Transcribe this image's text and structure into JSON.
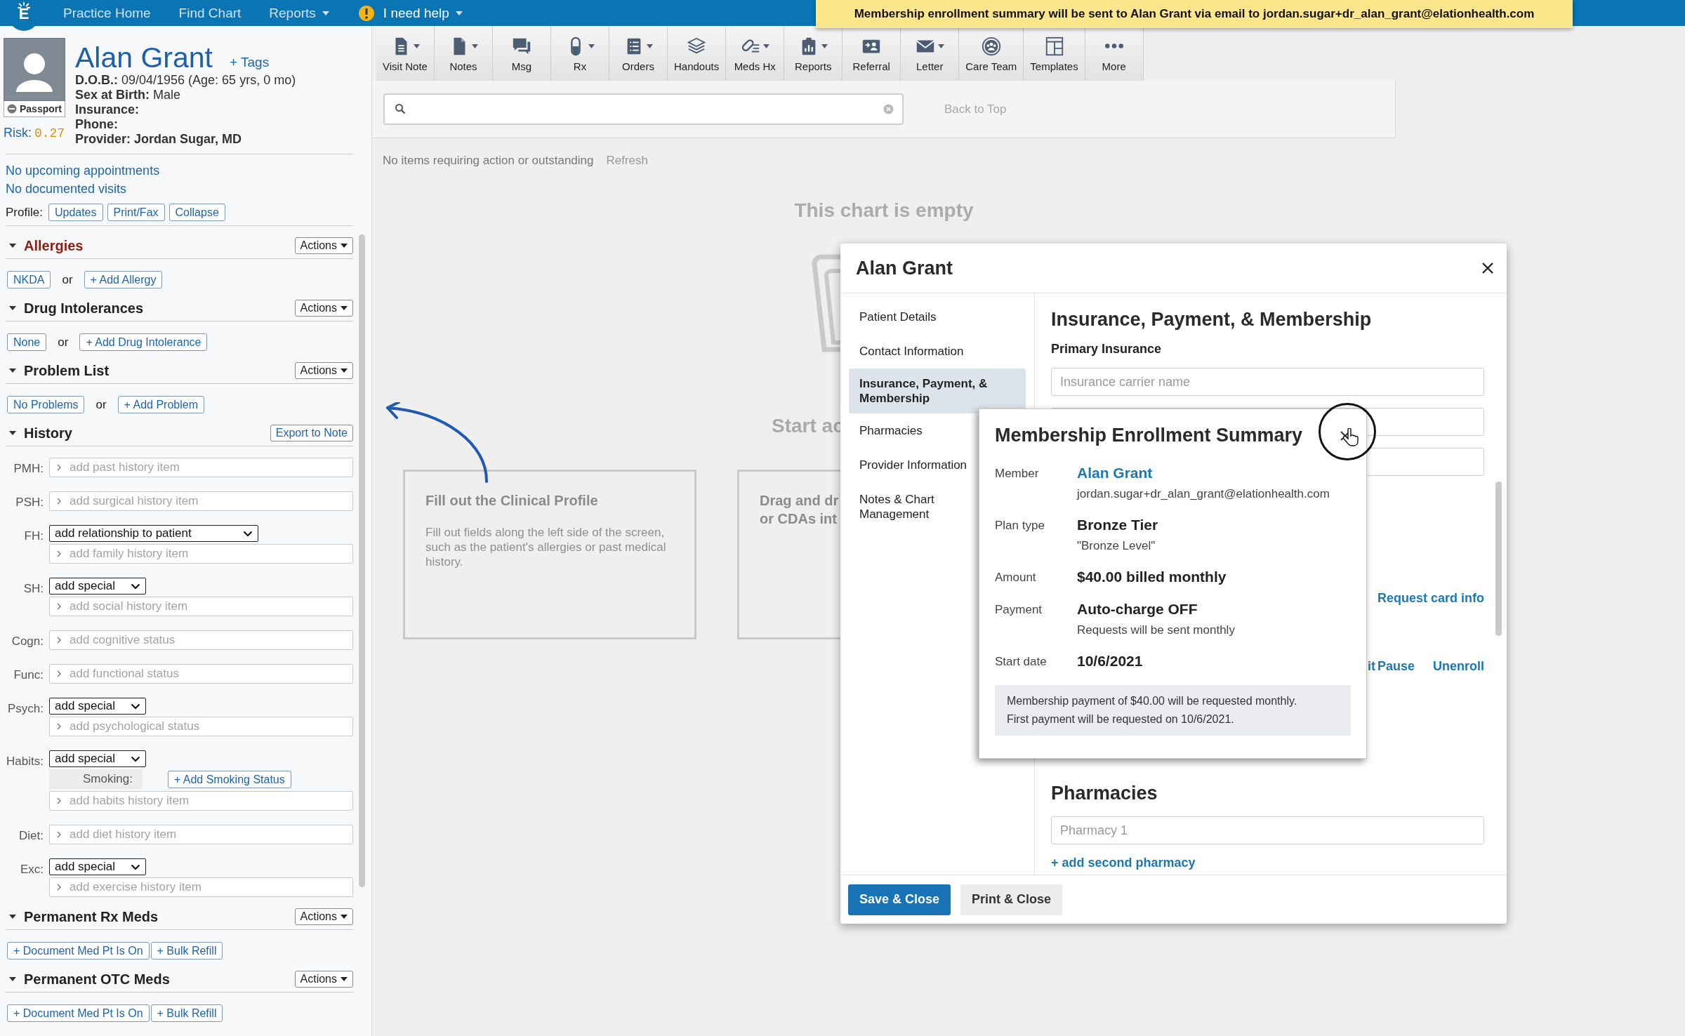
{
  "top_nav": {
    "logo": "E",
    "items": [
      {
        "label": "Practice Home",
        "dropdown": false,
        "alert": false
      },
      {
        "label": "Find Chart",
        "dropdown": false,
        "alert": false
      },
      {
        "label": "Reports",
        "dropdown": true,
        "alert": false
      },
      {
        "label": "I need help",
        "dropdown": true,
        "alert": true
      }
    ]
  },
  "toast": {
    "message": "Membership enrollment summary will be sent to Alan Grant via email to jordan.sugar+dr_alan_grant@elationhealth.com"
  },
  "patient": {
    "name": "Alan Grant",
    "tags_link": "+ Tags",
    "passport": "Passport",
    "risk_label": "Risk:",
    "risk_value": "0.27",
    "details": [
      {
        "text": "**D.O.B.:** 09/04/1956 (Age: 65 yrs, 0 mo)",
        "bold": false
      },
      {
        "text": "**Sex at Birth:**  Male",
        "bold": false
      },
      {
        "text": "Insurance:",
        "bold": true
      },
      {
        "text": "Phone:",
        "bold": true
      },
      {
        "text": "Provider: Jordan Sugar, MD",
        "bold": true
      }
    ]
  },
  "visits": [
    "No upcoming appointments",
    "No documented visits"
  ],
  "profile": {
    "label": "Profile:",
    "buttons": [
      "Updates",
      "Print/Fax",
      "Collapse"
    ]
  },
  "sections": [
    {
      "title": "Allergies",
      "alert": true,
      "expanded": true,
      "header_button": {
        "label": "Actions",
        "kind": "menu"
      },
      "row": [
        {
          "kind": "button",
          "label": "NKDA"
        },
        {
          "kind": "text",
          "label": "or"
        },
        {
          "kind": "button",
          "label": "+ Add Allergy"
        }
      ]
    },
    {
      "title": "Drug Intolerances",
      "alert": false,
      "expanded": true,
      "header_button": {
        "label": "Actions",
        "kind": "menu"
      },
      "row": [
        {
          "kind": "button",
          "label": "None"
        },
        {
          "kind": "text",
          "label": "or"
        },
        {
          "kind": "button",
          "label": "+ Add Drug Intolerance"
        }
      ]
    },
    {
      "title": "Problem List",
      "alert": false,
      "expanded": true,
      "header_button": {
        "label": "Actions",
        "kind": "menu"
      },
      "row": [
        {
          "kind": "button",
          "label": "No Problems"
        },
        {
          "kind": "text",
          "label": "or"
        },
        {
          "kind": "button",
          "label": "+ Add Problem"
        }
      ]
    },
    {
      "title": "History",
      "alert": false,
      "expanded": true,
      "header_button": {
        "label": "Export to Note",
        "kind": "link"
      },
      "history": [
        {
          "label": "PMH:",
          "fields": [
            {
              "kind": "input",
              "placeholder": "add past history item"
            }
          ]
        },
        {
          "label": "PSH:",
          "fields": [
            {
              "kind": "input",
              "placeholder": "add surgical history item"
            }
          ]
        },
        {
          "label": "FH:",
          "fields": [
            {
              "kind": "select",
              "value": "add relationship to patient",
              "wide": true
            },
            {
              "kind": "input",
              "placeholder": "add family history item"
            }
          ]
        },
        {
          "label": "SH:",
          "fields": [
            {
              "kind": "select",
              "value": "add special",
              "wide": false
            },
            {
              "kind": "input",
              "placeholder": "add social history item"
            }
          ]
        },
        {
          "label": "Cogn:",
          "fields": [
            {
              "kind": "input",
              "placeholder": "add cognitive status"
            }
          ]
        },
        {
          "label": "Func:",
          "fields": [
            {
              "kind": "input",
              "placeholder": "add functional status"
            }
          ]
        },
        {
          "label": "Psych:",
          "fields": [
            {
              "kind": "select",
              "value": "add special",
              "wide": false
            },
            {
              "kind": "input",
              "placeholder": "add psychological status"
            }
          ]
        },
        {
          "label": "Habits:",
          "fields": [
            {
              "kind": "select",
              "value": "add special",
              "wide": false
            },
            {
              "kind": "smoking",
              "label": "Smoking:",
              "button": "+ Add Smoking Status"
            },
            {
              "kind": "input",
              "placeholder": "add habits history item"
            }
          ]
        },
        {
          "label": "Diet:",
          "fields": [
            {
              "kind": "input",
              "placeholder": "add diet history item"
            }
          ]
        },
        {
          "label": "Exc:",
          "fields": [
            {
              "kind": "select",
              "value": "add special",
              "wide": false
            },
            {
              "kind": "input",
              "placeholder": "add exercise history item"
            }
          ]
        }
      ]
    },
    {
      "title": "Permanent Rx Meds",
      "alert": false,
      "expanded": true,
      "header_button": {
        "label": "Actions",
        "kind": "menu"
      },
      "row": [
        {
          "kind": "button",
          "label": "+ Document Med Pt Is On"
        },
        {
          "kind": "button",
          "label": "+ Bulk Refill"
        }
      ]
    },
    {
      "title": "Permanent OTC Meds",
      "alert": false,
      "expanded": true,
      "header_button": {
        "label": "Actions",
        "kind": "menu"
      },
      "row": [
        {
          "kind": "button",
          "label": "+ Document Med Pt Is On"
        },
        {
          "kind": "button",
          "label": "+ Bulk Refill"
        }
      ]
    }
  ],
  "toolbar": [
    {
      "label": "Visit Note",
      "dropdown": true
    },
    {
      "label": "Notes",
      "dropdown": true
    },
    {
      "label": "Msg",
      "dropdown": false
    },
    {
      "label": "Rx",
      "dropdown": true
    },
    {
      "label": "Orders",
      "dropdown": true
    },
    {
      "label": "Handouts",
      "dropdown": false
    },
    {
      "label": "Meds Hx",
      "dropdown": true
    },
    {
      "label": "Reports",
      "dropdown": true
    },
    {
      "label": "Referral",
      "dropdown": false
    },
    {
      "label": "Letter",
      "dropdown": true
    },
    {
      "label": "Care Team",
      "dropdown": false
    },
    {
      "label": "Templates",
      "dropdown": false
    },
    {
      "label": "More",
      "dropdown": false
    }
  ],
  "back_to_top": "Back to Top",
  "status": {
    "text": "No items requiring action or outstanding",
    "refresh": "Refresh"
  },
  "empty_state": {
    "title": "This chart is empty",
    "start_text": "Start ac",
    "cards": [
      {
        "title_lines": [
          "Fill out the Clinical Profile"
        ],
        "body": "Fill out fields along the left side of the screen, such as the patient's allergies or past medical history."
      },
      {
        "title_lines": [
          "Drag and dr",
          "or CDAs int"
        ]
      }
    ]
  },
  "dialog": {
    "title": "Alan Grant",
    "nav": [
      {
        "label": "Patient Details",
        "selected": false
      },
      {
        "label": "Contact Information",
        "selected": false
      },
      {
        "label": "Insurance, Payment, & Membership",
        "selected": true
      },
      {
        "label": "Pharmacies",
        "selected": false
      },
      {
        "label": "Provider Information",
        "selected": false
      },
      {
        "label": "Notes & Chart Management",
        "selected": false
      }
    ],
    "heading": "Insurance, Payment, & Membership",
    "primary_insurance": "Primary Insurance",
    "carrier_placeholder": "Insurance carrier name",
    "request_card_info": "Request card info",
    "membership_actions": [
      "it",
      "Pause",
      "Unenroll"
    ],
    "pharmacies_heading": "Pharmacies",
    "pharmacy_placeholder": "Pharmacy 1",
    "add_pharmacy": "+ add second pharmacy",
    "buttons": [
      {
        "label": "Save & Close",
        "kind": "primary"
      },
      {
        "label": "Print & Close",
        "kind": "secondary"
      }
    ]
  },
  "popup": {
    "title": "Membership Enrollment Summary",
    "rows": [
      {
        "label": "Member",
        "value": "Alan Grant",
        "kind": "link",
        "sub": "jordan.sugar+dr_alan_grant@elationhealth.com"
      },
      {
        "label": "Plan type",
        "value": "Bronze Tier",
        "kind": "text",
        "sub": "\"Bronze Level\""
      },
      {
        "label": "Amount",
        "value": "$40.00 billed monthly",
        "kind": "text"
      },
      {
        "label": "Payment",
        "value": "Auto-charge OFF",
        "kind": "text",
        "sub": "Requests will be sent monthly"
      },
      {
        "label": "Start date",
        "value": "10/6/2021",
        "kind": "text"
      }
    ],
    "note_lines": [
      "Membership payment of $40.00 will be requested monthly.",
      "First payment will be requested on 10/6/2021."
    ]
  }
}
